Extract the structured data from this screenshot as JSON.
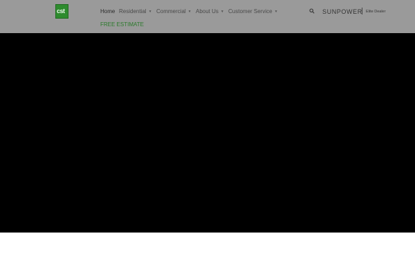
{
  "header": {
    "logo_text": "cst",
    "nav": {
      "items": [
        {
          "label": "Home",
          "has_dropdown": false,
          "active": true
        },
        {
          "label": "Residential",
          "has_dropdown": true,
          "active": false
        },
        {
          "label": "Commercial",
          "has_dropdown": true,
          "active": false
        },
        {
          "label": "About Us",
          "has_dropdown": true,
          "active": false
        },
        {
          "label": "Customer Service",
          "has_dropdown": true,
          "active": false
        }
      ],
      "free_estimate": "FREE ESTIMATE"
    },
    "sunpower": {
      "brand": "SUNPOWER",
      "dealer_label": "Elite Dealer"
    }
  },
  "colors": {
    "header_bg": "#9a9a9a",
    "hero_bg": "#000000",
    "accent_green": "#2b7a2b"
  }
}
